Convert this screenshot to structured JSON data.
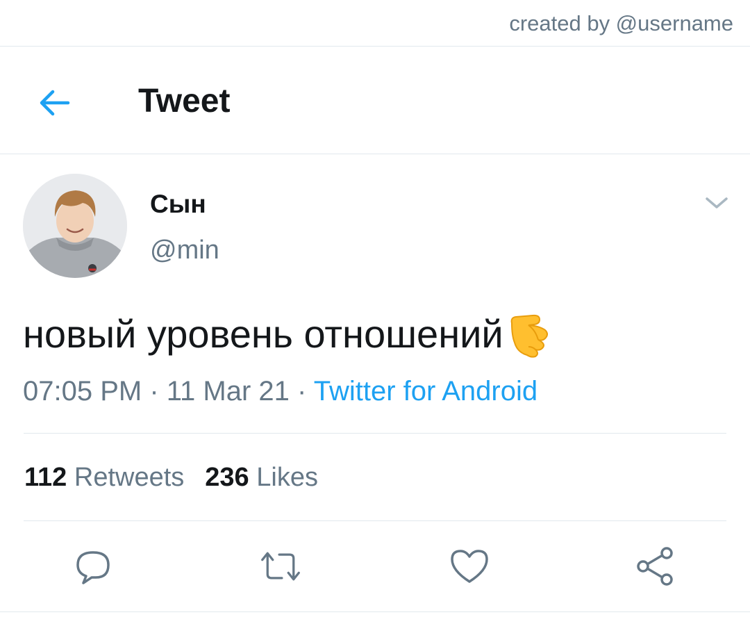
{
  "credit": "created by @username",
  "header": {
    "title": "Tweet",
    "back_icon": "arrow-left-icon"
  },
  "tweet": {
    "author_name": "Сын",
    "author_handle": "@min",
    "text": "новый уровень отношений",
    "emoji": "🫰",
    "time": "07:05 PM",
    "separator": " · ",
    "date": "11 Mar 21",
    "source": "Twitter for Android",
    "retweets_count": "112",
    "retweets_label": "Retweets",
    "likes_count": "236",
    "likes_label": "Likes"
  },
  "actions": [
    "reply-icon",
    "retweet-icon",
    "like-icon",
    "share-icon"
  ],
  "colors": {
    "accent": "#1da1f2",
    "secondary_text": "#657786",
    "divider": "#e1e8ed",
    "primary_text": "#14171a"
  }
}
